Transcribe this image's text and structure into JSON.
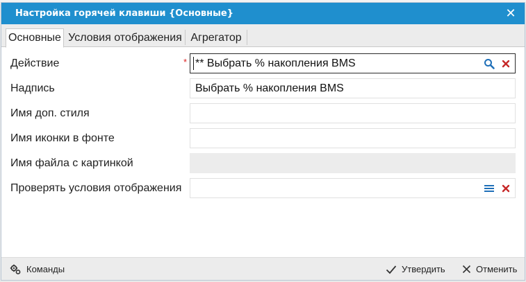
{
  "window": {
    "title": "Настройка горячей клавиши {Основные}",
    "close_icon": "close-icon"
  },
  "tabs": [
    {
      "label": "Основные",
      "active": true
    },
    {
      "label": "Условия отображения",
      "active": false
    },
    {
      "label": "Агрегатор",
      "active": false
    }
  ],
  "form": {
    "action": {
      "label": "Действие",
      "required_mark": "*",
      "value": "** Выбрать % накопления BMS"
    },
    "caption": {
      "label": "Надпись",
      "value": "Выбрать % накопления BMS"
    },
    "extra_style": {
      "label": "Имя доп. стиля",
      "value": ""
    },
    "font_icon": {
      "label": "Имя иконки в фонте",
      "value": ""
    },
    "image_file": {
      "label": "Имя файла с картинкой",
      "value": ""
    },
    "check_display": {
      "label": "Проверять условия отображения",
      "value": ""
    }
  },
  "footer": {
    "commands_label": "Команды",
    "confirm_label": "Утвердить",
    "cancel_label": "Отменить"
  },
  "colors": {
    "titlebar": "#1f8fce",
    "required": "#dd2222",
    "clear_icon": "#c62828",
    "search_icon": "#1e6fb8"
  }
}
